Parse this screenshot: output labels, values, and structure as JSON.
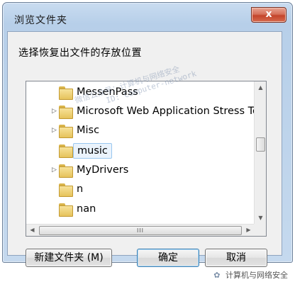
{
  "window": {
    "title": "浏览文件夹",
    "close_glyph": "x"
  },
  "dialog": {
    "prompt": "选择恢复出文件的存放位置",
    "folders": [
      {
        "name": "MessenPass",
        "expander": ""
      },
      {
        "name": "Microsoft Web Application Stress Tool",
        "expander": "▷"
      },
      {
        "name": "Misc",
        "expander": "▷"
      },
      {
        "name": "music",
        "expander": "",
        "selected": true
      },
      {
        "name": "MyDrivers",
        "expander": "▷"
      },
      {
        "name": "n",
        "expander": ""
      },
      {
        "name": "nan",
        "expander": ""
      }
    ],
    "scroll": {
      "up": "▲",
      "down": "▼",
      "left": "◀",
      "right": "▶",
      "grip": "III"
    }
  },
  "buttons": {
    "new_folder": "新建文件夹 (M)",
    "ok": "确定",
    "cancel": "取消"
  },
  "watermark": {
    "line1": "微信公众号：计算机与网络安全",
    "line2": "ID: Computer-network"
  },
  "footer": {
    "icon": "✿",
    "text": "计算机与网络安全"
  }
}
